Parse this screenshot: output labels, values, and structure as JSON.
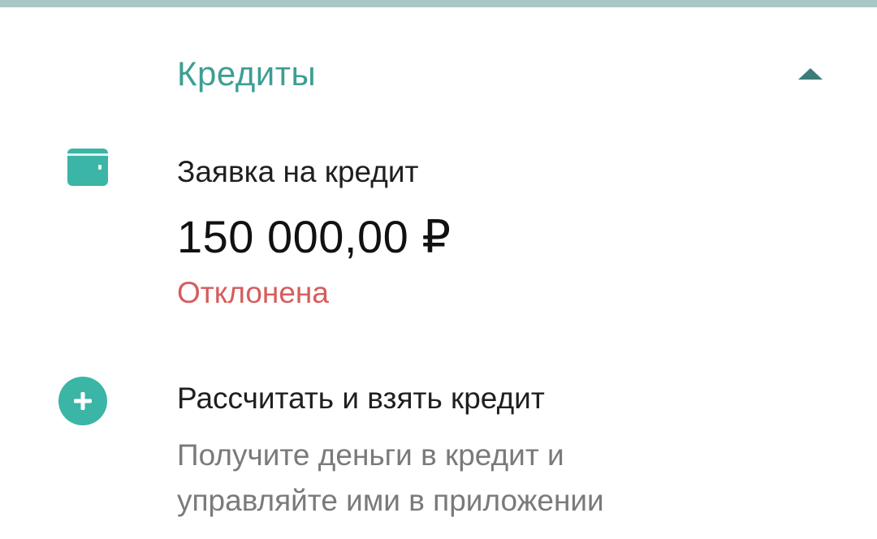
{
  "section": {
    "title": "Кредиты",
    "collapse_icon": "chevron-up-icon",
    "accent_color": "#3e9e93"
  },
  "application": {
    "icon": "wallet-icon",
    "title": "Заявка на кредит",
    "amount": "150 000,00 ₽",
    "status": "Отклонена",
    "status_color": "#d75c5c"
  },
  "calculate": {
    "icon": "plus-circle-icon",
    "title": "Рассчитать и взять кредит",
    "description_line1": "Получите деньги в кредит и",
    "description_line2": "управляйте ими в приложении"
  }
}
